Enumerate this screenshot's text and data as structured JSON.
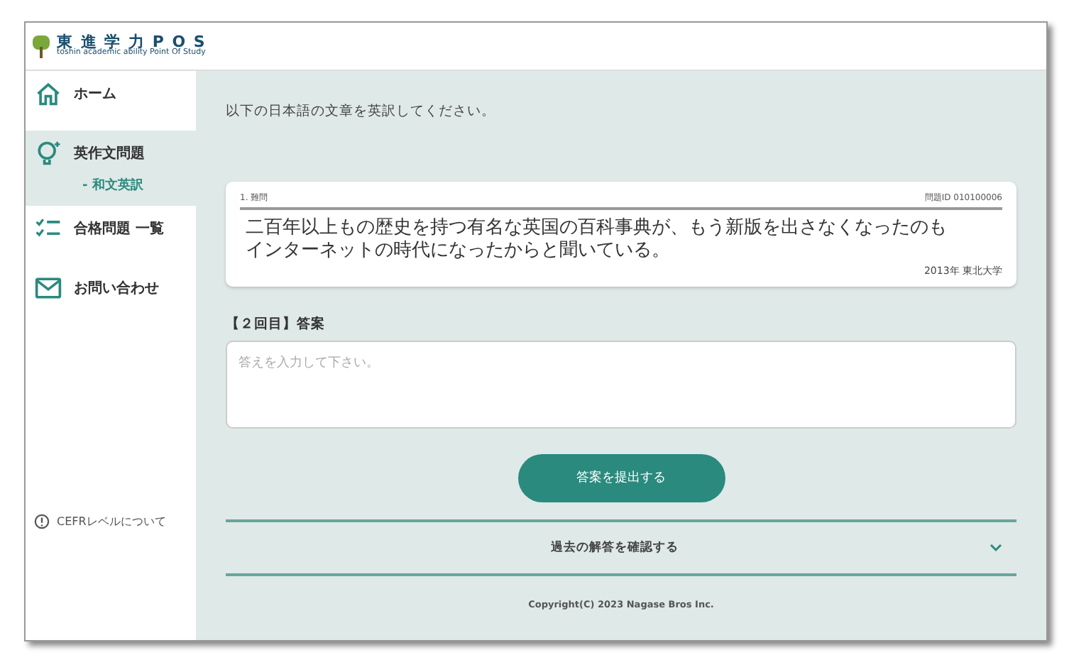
{
  "header": {
    "logo_title": "東 進 学 力 P O S",
    "logo_subtitle": "toshin academic ability Point Of Study"
  },
  "sidebar": {
    "items": [
      {
        "kind": "home",
        "label": "ホーム",
        "selected": false
      },
      {
        "kind": "bulb",
        "label": "英作文問題",
        "selected": true,
        "children": [
          {
            "label": "- 和文英訳"
          }
        ]
      },
      {
        "kind": "checklist",
        "label": "合格問題 一覧",
        "selected": false
      },
      {
        "kind": "mail",
        "label": "お問い合わせ",
        "selected": false
      }
    ],
    "footer_link": "CEFRレベルについて"
  },
  "main": {
    "instruction": "以下の日本語の文章を英訳してください。",
    "question": {
      "number": "1. 難問",
      "id": "問題ID 010100006",
      "text_lines": [
        "二百年以上もの歴史を持つ有名な英国の百科事典が、もう新版を出さなくなったのも",
        "インターネットの時代になったからと聞いている。"
      ],
      "source": "2013年 東北大学"
    },
    "answer_label": "【２回目】答案",
    "answer": {
      "placeholder": "答えを入力して下さい。"
    },
    "submit": "答案を提出する",
    "history": {
      "label": "過去の解答を確認する",
      "expanded": false
    },
    "copyright": "Copyright(C) 2023 Nagase Bros Inc."
  }
}
